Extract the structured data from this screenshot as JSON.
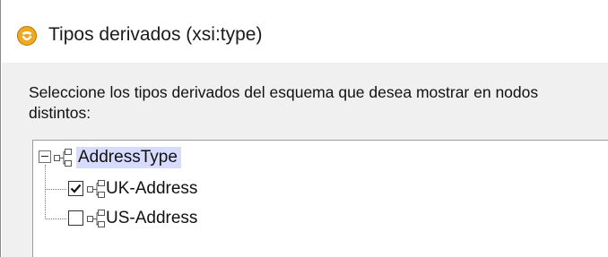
{
  "dialog": {
    "title": "Tipos derivados (xsi:type)",
    "title_icon": "altova-mapforce-icon",
    "description": "Seleccione los tipos derivados del esquema que desea mostrar en nodos distintos:"
  },
  "tree": {
    "root": {
      "label": "AddressType",
      "icon": "complex-type-icon",
      "expanded": true,
      "selected": true
    },
    "children": [
      {
        "label": "UK-Address",
        "icon": "complex-type-icon",
        "checked": true
      },
      {
        "label": "US-Address",
        "icon": "complex-type-icon",
        "checked": false
      }
    ]
  },
  "colors": {
    "accent_icon": "#f0a81e",
    "selection": "#d7dcff"
  }
}
